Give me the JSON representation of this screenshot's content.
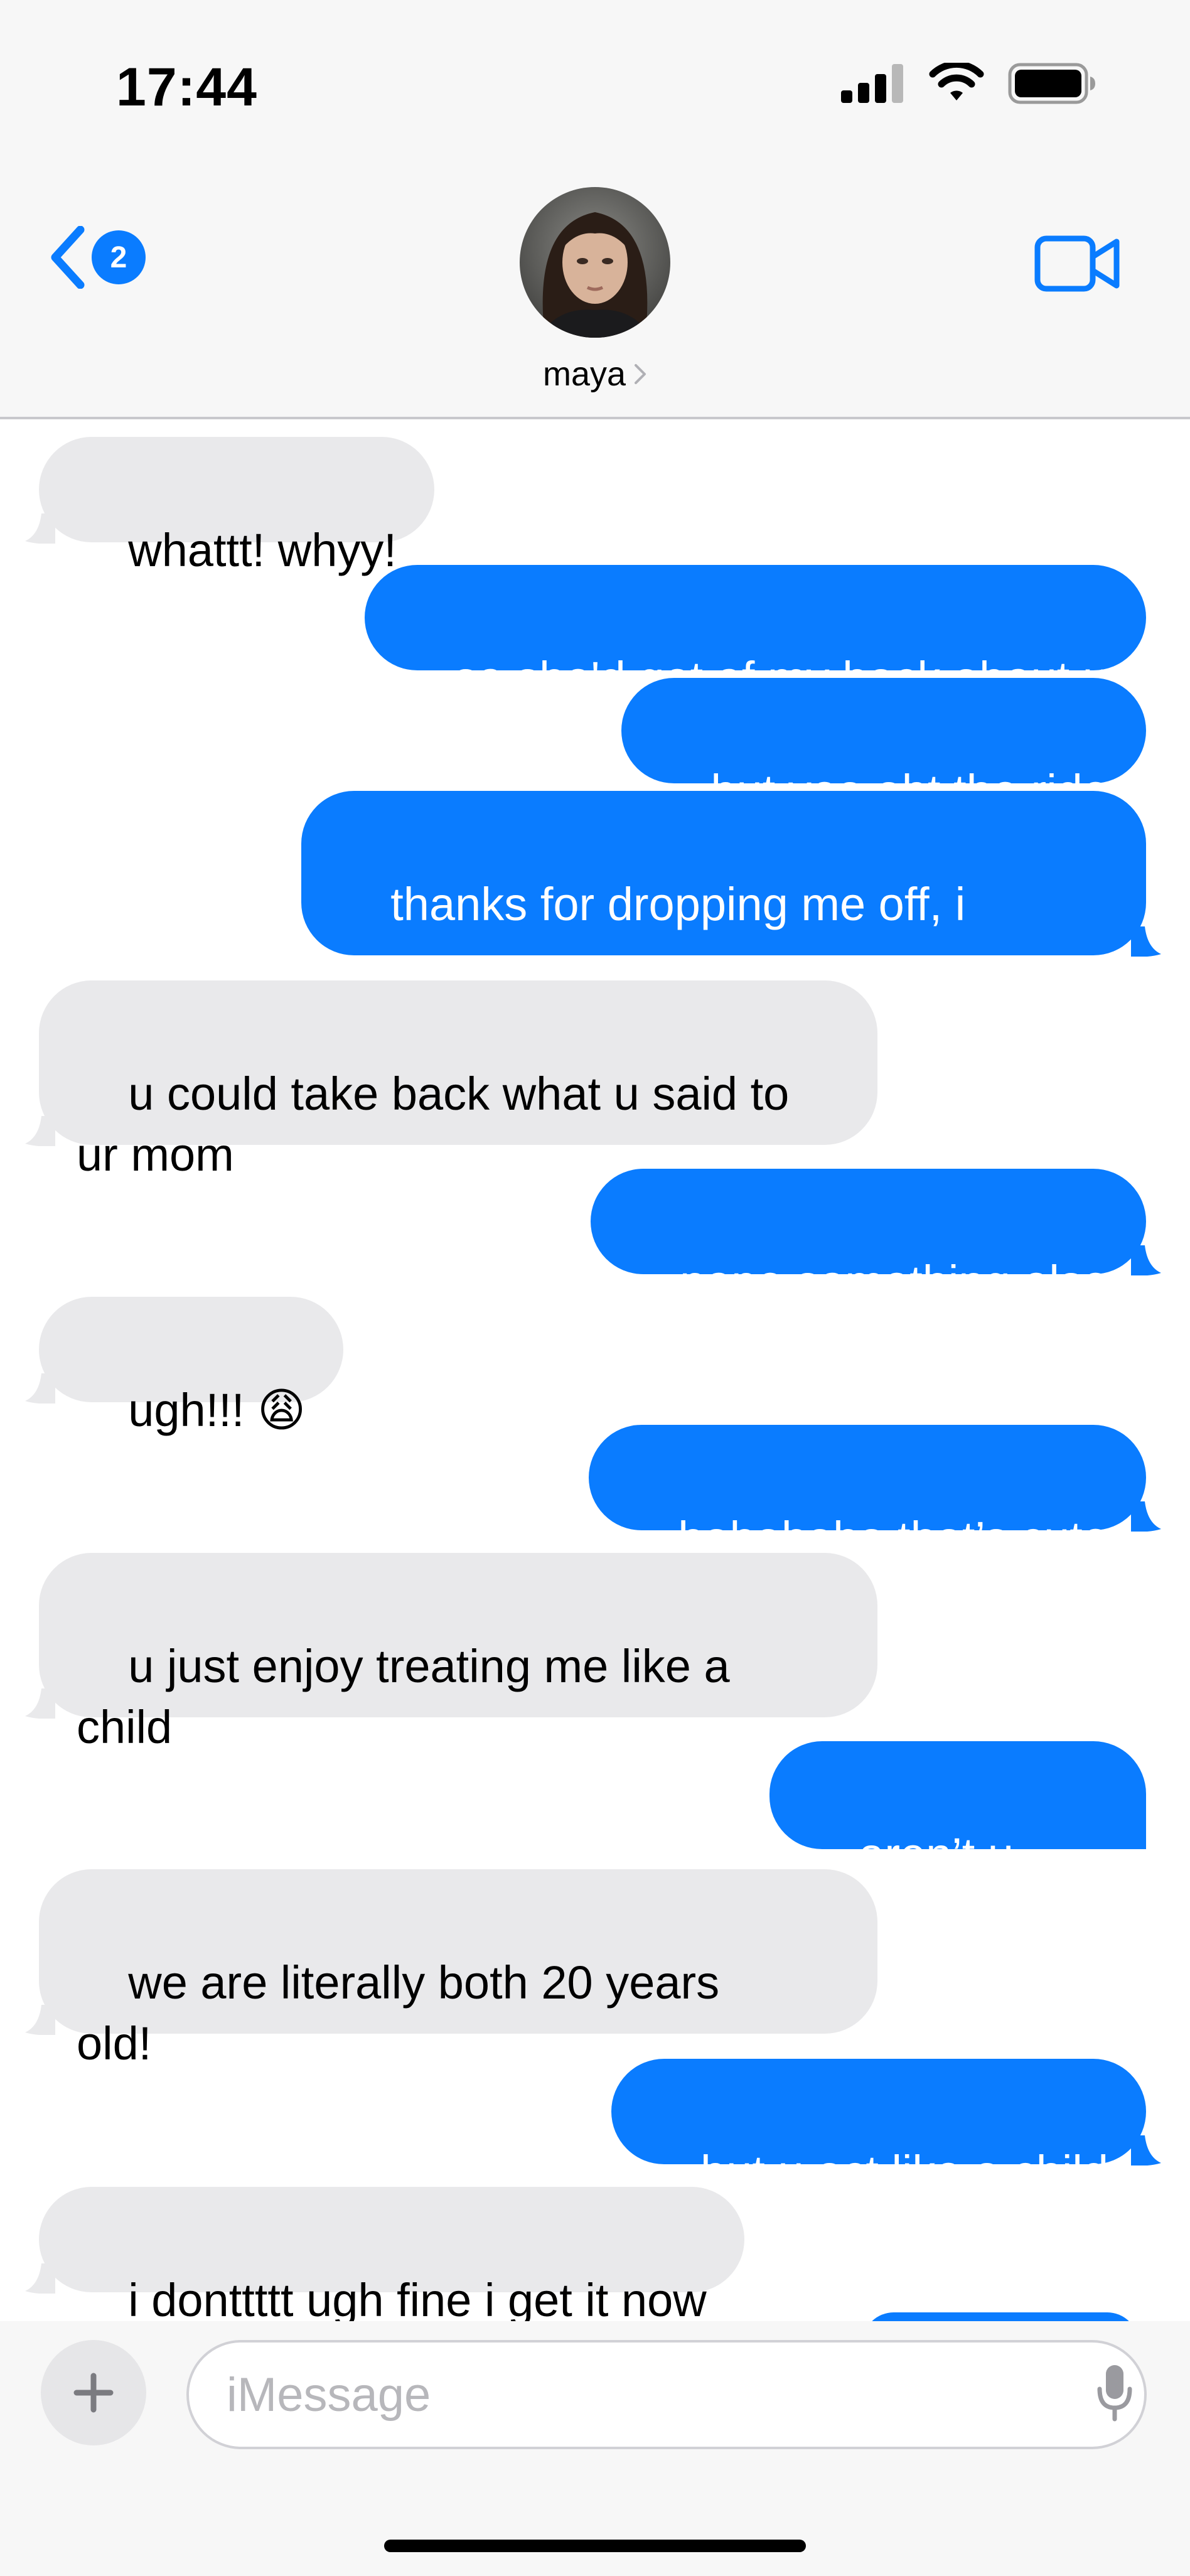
{
  "status_bar": {
    "time": "17:44"
  },
  "header": {
    "unread_count": "2",
    "contact_name": "maya"
  },
  "messages": [
    {
      "dir": "in",
      "text": "whattt! whyy!"
    },
    {
      "dir": "out",
      "text": "so she'd get of my back about u"
    },
    {
      "dir": "out",
      "text": "but yea abt the ride"
    },
    {
      "dir": "out",
      "text": "thanks for dropping me off, i\nowe u"
    },
    {
      "dir": "in",
      "text": "u could take back what u said to\nur mom"
    },
    {
      "dir": "out",
      "text": "nope something else"
    },
    {
      "dir": "in",
      "text": "ugh!!! 😩"
    },
    {
      "dir": "out",
      "text": "hahahaha that’s cute"
    },
    {
      "dir": "in",
      "text": "u just enjoy treating me like a\nchild"
    },
    {
      "dir": "out",
      "text": "aren’t u\nune?"
    },
    {
      "dir": "in",
      "text": "we are literally both 20 years\nold!"
    },
    {
      "dir": "out",
      "text": "but u act like a child"
    },
    {
      "dir": "in",
      "text": "i donttttt ugh fine i get it now"
    }
  ],
  "composer": {
    "placeholder": "iMessage"
  },
  "colors": {
    "outgoing_bubble": "#0a7cff",
    "incoming_bubble": "#e9e9eb",
    "accent": "#0a7cff"
  },
  "icons": [
    "signal-icon",
    "wifi-icon",
    "battery-icon",
    "back-chevron-icon",
    "video-camera-icon",
    "plus-icon",
    "microphone-icon",
    "chevron-right-icon"
  ]
}
